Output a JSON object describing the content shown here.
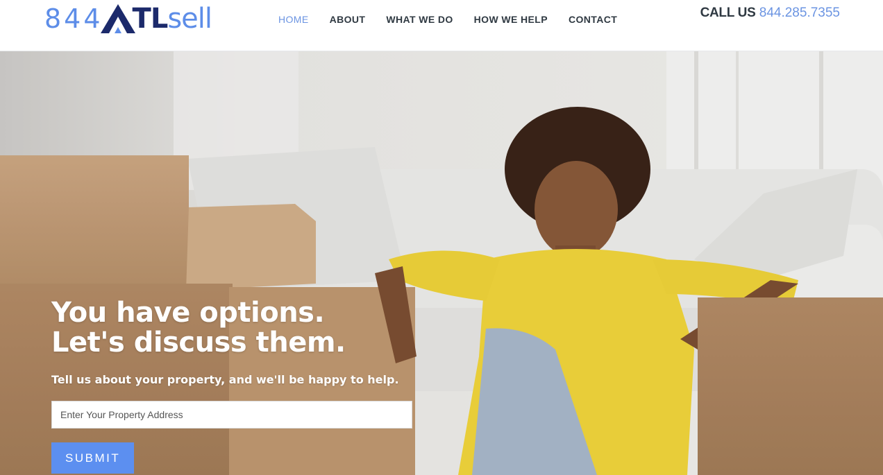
{
  "header": {
    "logo": {
      "prefix": "844",
      "mark_letter": "A",
      "middle": "TL",
      "suffix": "sell"
    },
    "nav": [
      {
        "label": "HOME",
        "active": true
      },
      {
        "label": "ABOUT",
        "active": false
      },
      {
        "label": "WHAT WE DO",
        "active": false
      },
      {
        "label": "HOW WE HELP",
        "active": false
      },
      {
        "label": "CONTACT",
        "active": false
      }
    ],
    "call_label": "CALL US",
    "phone": "844.285.7355"
  },
  "hero": {
    "headline_line1": "You have options.",
    "headline_line2": "Let's discuss them.",
    "subline": "Tell us about your property, and we'll be happy to help.",
    "address_placeholder": "Enter Your Property Address",
    "submit_label": "SUBMIT"
  },
  "colors": {
    "brand_blue": "#5d8de8",
    "brand_navy": "#1c2a6b",
    "nav_text": "#2f3942",
    "nav_active": "#6b94e2",
    "button": "#5c8ff0"
  }
}
